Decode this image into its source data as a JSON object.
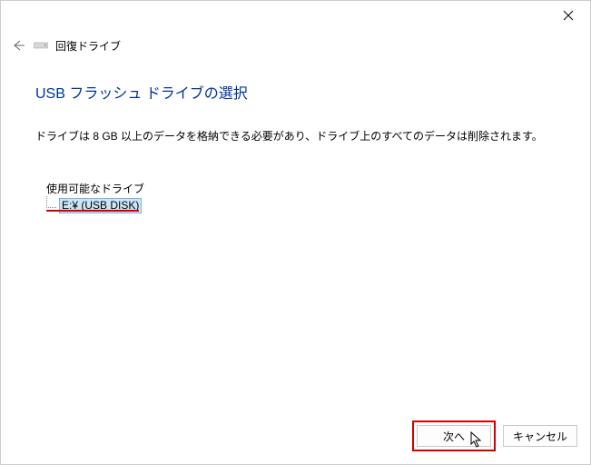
{
  "header": {
    "wizard_title": "回復ドライブ"
  },
  "page": {
    "title": "USB フラッシュ ドライブの選択",
    "description": "ドライブは 8 GB 以上のデータを格納できる必要があり、ドライブ上のすべてのデータは削除されます。"
  },
  "tree": {
    "root_label": "使用可能なドライブ",
    "items": [
      {
        "label": "E:¥ (USB DISK)",
        "selected": true
      }
    ]
  },
  "buttons": {
    "next": "次へ",
    "cancel": "キャンセル"
  }
}
